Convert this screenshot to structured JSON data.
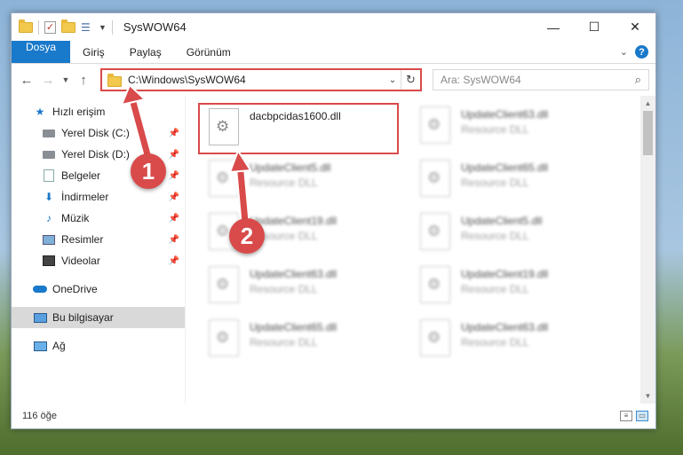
{
  "window": {
    "title": "SysWOW64",
    "controls": {
      "minimize": "—",
      "maximize": "☐",
      "close": "✕"
    }
  },
  "ribbon": {
    "tabs": [
      "Dosya",
      "Giriş",
      "Paylaş",
      "Görünüm"
    ],
    "help": "?"
  },
  "address": {
    "path": "C:\\Windows\\SysWOW64",
    "refresh": "↻"
  },
  "search": {
    "placeholder": "Ara: SysWOW64"
  },
  "sidebar": {
    "quick_access": "Hızlı erişim",
    "items": [
      {
        "label": "Yerel Disk (C:)",
        "icon": "drive-icon"
      },
      {
        "label": "Yerel Disk (D:)",
        "icon": "drive-icon"
      },
      {
        "label": "Belgeler",
        "icon": "documents-icon"
      },
      {
        "label": "İndirmeler",
        "icon": "downloads-icon"
      },
      {
        "label": "Müzik",
        "icon": "music-icon"
      },
      {
        "label": "Resimler",
        "icon": "pictures-icon"
      },
      {
        "label": "Videolar",
        "icon": "videos-icon"
      }
    ],
    "onedrive": "OneDrive",
    "this_pc": "Bu bilgisayar",
    "network": "Ağ"
  },
  "files": [
    {
      "name": "dacbpcidas1600.dll",
      "type": "",
      "highlight": true
    },
    {
      "name": "UpdateClient63.dll",
      "type": "Resource DLL"
    },
    {
      "name": "UpdateClient5.dll",
      "type": "Resource DLL"
    },
    {
      "name": "UpdateClient65.dll",
      "type": "Resource DLL"
    },
    {
      "name": "UpdateClient19.dll",
      "type": "Resource DLL"
    },
    {
      "name": "UpdateClient5.dll",
      "type": "Resource DLL"
    },
    {
      "name": "UpdateClient63.dll",
      "type": "Resource DLL"
    },
    {
      "name": "UpdateClient19.dll",
      "type": "Resource DLL"
    },
    {
      "name": "UpdateClient65.dll",
      "type": "Resource DLL"
    },
    {
      "name": "UpdateClient63.dll",
      "type": "Resource DLL"
    }
  ],
  "status": {
    "count": "116 öğe"
  },
  "callouts": [
    "1",
    "2"
  ],
  "colors": {
    "accent": "#1979ca",
    "callout": "#d94a4a"
  }
}
